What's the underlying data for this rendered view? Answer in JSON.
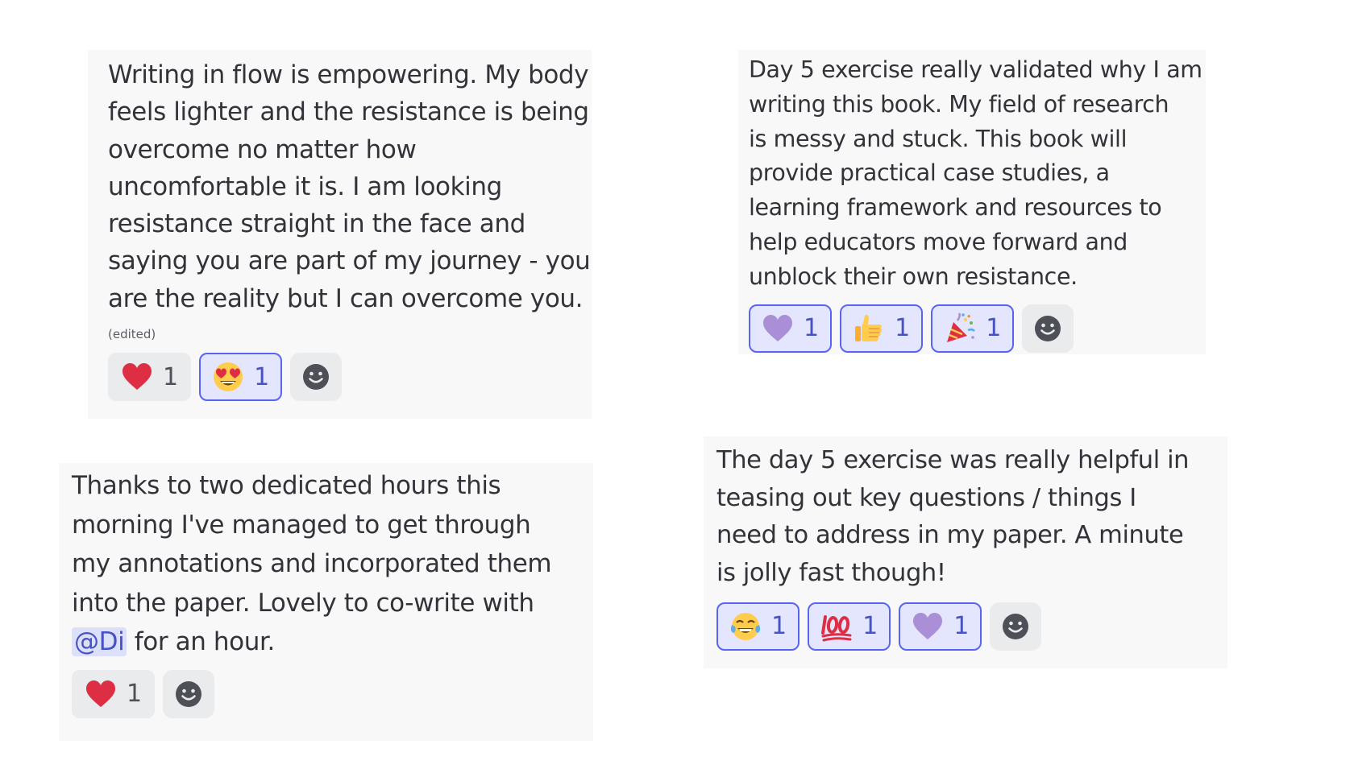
{
  "colors": {
    "card_background": "#f8f8f9",
    "reaction_background": "#eaebed",
    "active_reaction_background": "#e3e6fc",
    "active_reaction_border": "#5865f2",
    "mention_background": "#dde0fb",
    "mention_text": "#4752c4",
    "text": "#313338"
  },
  "messages": [
    {
      "lines": [
        "Writing in flow is empowering. My body",
        "feels lighter and the resistance is being",
        "overcome no matter how",
        "uncomfortable it is. I am looking",
        "resistance straight in the face and",
        "saying you are part of my journey - you",
        "are the reality but I can overcome you."
      ],
      "edited_label": "(edited)",
      "reactions": [
        {
          "emoji": "red-heart",
          "count": "1",
          "active": false
        },
        {
          "emoji": "heart-eyes-face",
          "count": "1",
          "active": true
        }
      ],
      "add_reaction_icon": "smiley-face-icon"
    },
    {
      "lines": [
        "Day 5 exercise really validated why I am",
        "writing this book. My field of research",
        "is messy and stuck. This book will",
        "provide practical case studies, a",
        "learning framework and resources to",
        "help educators move forward and",
        "unblock their own resistance."
      ],
      "reactions": [
        {
          "emoji": "purple-heart",
          "count": "1",
          "active": true
        },
        {
          "emoji": "thumbs-up",
          "count": "1",
          "active": true
        },
        {
          "emoji": "party-popper",
          "count": "1",
          "active": true
        }
      ],
      "add_reaction_icon": "smiley-face-icon"
    },
    {
      "lines": [
        "Thanks to two dedicated hours this",
        "morning I've managed to get through",
        "my annotations and incorporated them",
        "into the paper. Lovely to co-write with"
      ],
      "mention": "@Di",
      "last_line_after_mention": " for an hour.",
      "reactions": [
        {
          "emoji": "red-heart",
          "count": "1",
          "active": false
        }
      ],
      "add_reaction_icon": "smiley-face-icon"
    },
    {
      "lines": [
        "The day 5 exercise was really helpful in",
        "teasing out key questions / things I",
        "need to address in my paper. A minute",
        "is jolly fast though!"
      ],
      "reactions": [
        {
          "emoji": "tears-of-joy-face",
          "count": "1",
          "active": true
        },
        {
          "emoji": "hundred-points",
          "count": "1",
          "active": true
        },
        {
          "emoji": "purple-heart",
          "count": "1",
          "active": true
        }
      ],
      "add_reaction_icon": "smiley-face-icon"
    }
  ]
}
